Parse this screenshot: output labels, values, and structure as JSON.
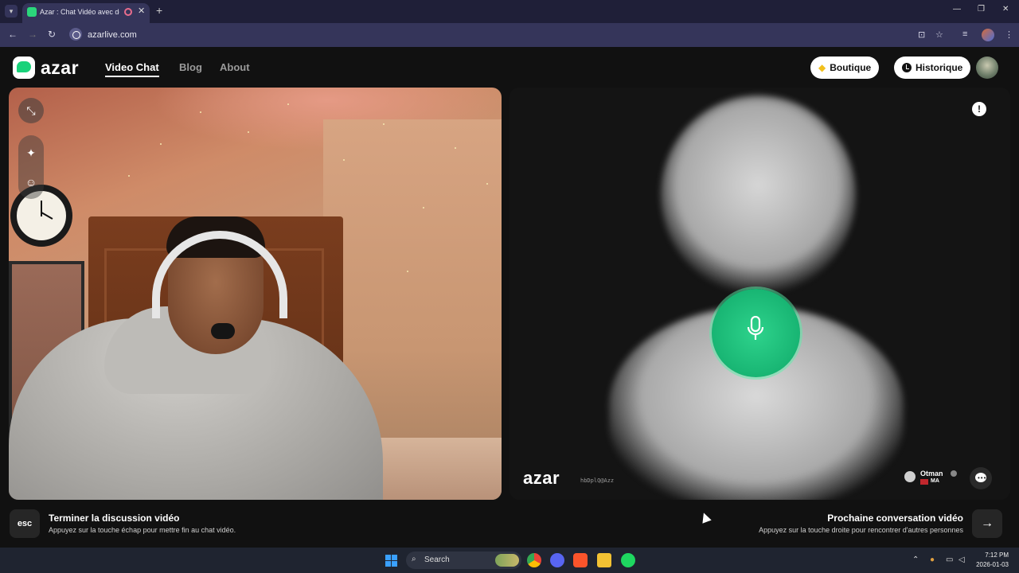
{
  "browser": {
    "tab_title": "Azar : Chat Vidéo avec de n",
    "url": "azarlive.com",
    "new_tab_label": "+",
    "tab_close_label": "✕"
  },
  "nav": {
    "logo_text": "azar",
    "links": [
      "Video Chat",
      "Blog",
      "About"
    ],
    "active_link": "Video Chat",
    "boutique_label": "Boutique",
    "historique_label": "Historique"
  },
  "remote": {
    "watermark_logo": "azar",
    "watermark_id": "hbDplQ@Azz",
    "peer_name": "Otman",
    "peer_country": "MA",
    "report_label": "!"
  },
  "actions": {
    "esc_key_label": "esc",
    "end_title": "Terminer la discussion vidéo",
    "end_subtitle": "Appuyez sur la touche échap pour mettre fin au chat vidéo.",
    "next_title": "Prochaine conversation vidéo",
    "next_subtitle": "Appuyez sur la touche droite pour rencontrer d'autres personnes",
    "next_arrow": "→"
  },
  "taskbar": {
    "search_label": "Search",
    "time": "7:12 PM",
    "date": "2026-01-03"
  },
  "colors": {
    "accent_green": "#19d27a",
    "page_bg": "#111111",
    "tab_bar": "#1f1f38"
  }
}
